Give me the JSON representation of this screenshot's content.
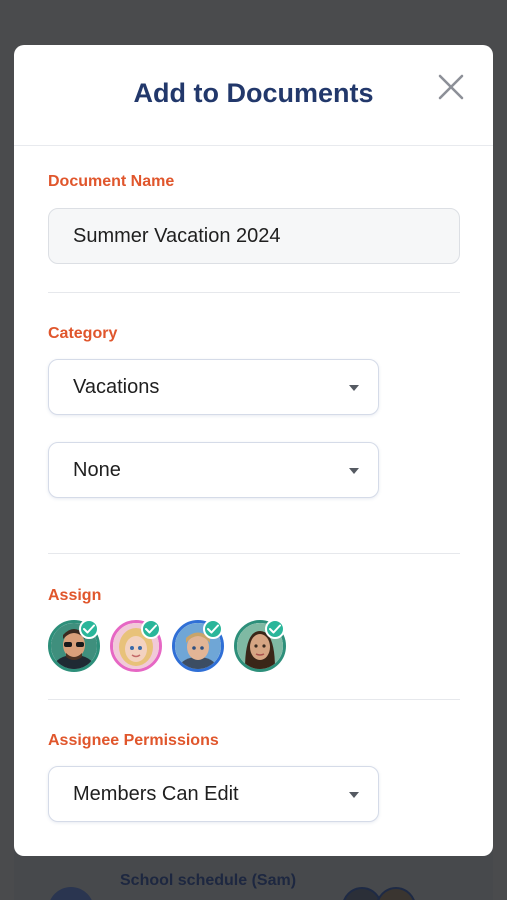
{
  "background": {
    "list_item_title": "School schedule (Sam)"
  },
  "modal": {
    "title": "Add to Documents",
    "close_icon": "close-icon"
  },
  "document_name": {
    "label": "Document Name",
    "value": "Summer Vacation 2024"
  },
  "category": {
    "label": "Category",
    "primary_selected": "Vacations",
    "secondary_selected": "None"
  },
  "assign": {
    "label": "Assign",
    "members": [
      {
        "name": "member-1",
        "selected": true,
        "ring_color": "#2d8f7a"
      },
      {
        "name": "member-2",
        "selected": true,
        "ring_color": "#e667c4"
      },
      {
        "name": "member-3",
        "selected": true,
        "ring_color": "#2f6fd6"
      },
      {
        "name": "member-4",
        "selected": true,
        "ring_color": "#2d8f7a"
      }
    ]
  },
  "permissions": {
    "label": "Assignee Permissions",
    "selected": "Members Can Edit"
  },
  "colors": {
    "title": "#22386b",
    "label_accent": "#e0562c",
    "check_badge": "#2ab69a"
  }
}
